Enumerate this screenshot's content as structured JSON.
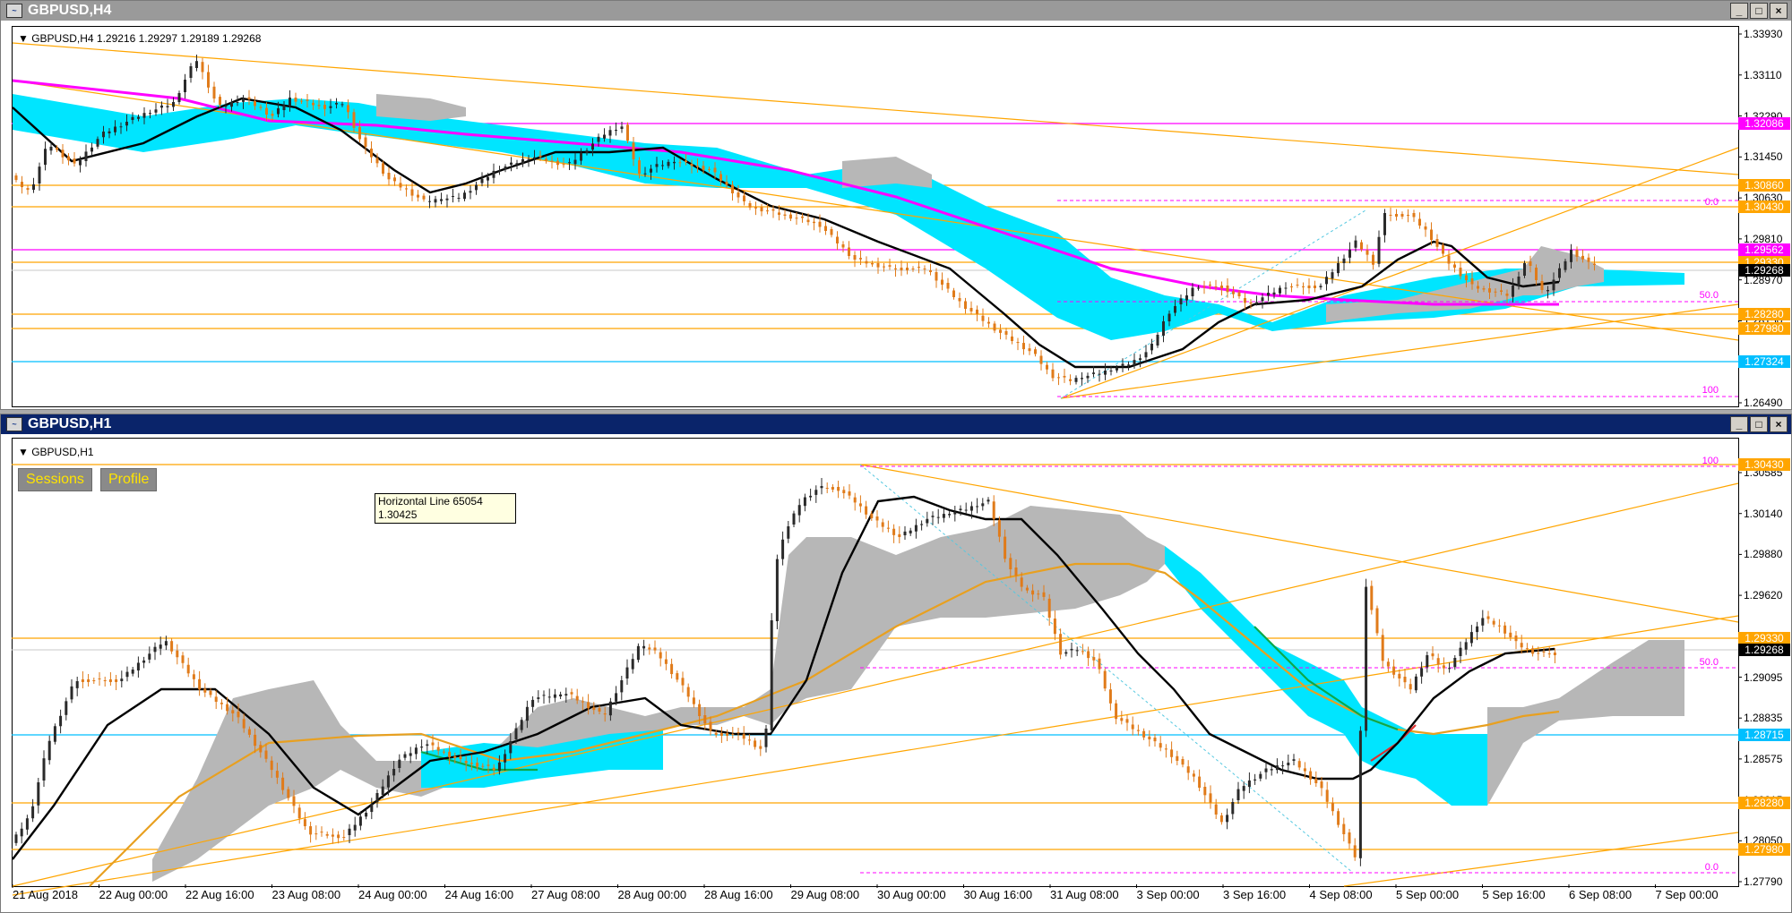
{
  "h4": {
    "title": "GBPUSD,H4",
    "info": "GBPUSD,H4  1.29216 1.29297 1.29189 1.29268",
    "axis_labels": [
      "1.33930",
      "1.33110",
      "1.32290",
      "1.31450",
      "1.30630",
      "1.29810",
      "1.28970",
      "1.28150",
      "1.27310",
      "1.26490"
    ],
    "tags": [
      {
        "text": "1.32086",
        "bg": "#ff00ff",
        "fg": "#ffffff"
      },
      {
        "text": "1.30860",
        "bg": "#ffa500",
        "fg": "#ffffff"
      },
      {
        "text": "1.30430",
        "bg": "#ffa500",
        "fg": "#ffffff"
      },
      {
        "text": "1.29562",
        "bg": "#ff00ff",
        "fg": "#ffffff"
      },
      {
        "text": "1.29330",
        "bg": "#ffa500",
        "fg": "#ffffff"
      },
      {
        "text": "1.29268",
        "bg": "#000000",
        "fg": "#ffffff"
      },
      {
        "text": "1.28280",
        "bg": "#ffa500",
        "fg": "#ffffff"
      },
      {
        "text": "1.27980",
        "bg": "#ffa500",
        "fg": "#ffffff"
      },
      {
        "text": "1.27324",
        "bg": "#00bfff",
        "fg": "#ffffff"
      }
    ],
    "fib": {
      "top": "0.0",
      "mid": "50.0",
      "bottom": "100"
    }
  },
  "h1": {
    "title": "GBPUSD,H1",
    "info": "GBPUSD,H1",
    "buttons": {
      "sessions": "Sessions",
      "profile": "Profile"
    },
    "tooltip": {
      "line1": "Horizontal Line 65054",
      "line2": "1.30425"
    },
    "axis_labels": [
      "1.30585",
      "1.30140",
      "1.29880",
      "1.29620",
      "1.29360",
      "1.29095",
      "1.28835",
      "1.28575",
      "1.28315",
      "1.28050",
      "1.27790"
    ],
    "tags": [
      {
        "text": "1.30430",
        "bg": "#ffa500",
        "fg": "#ffffff"
      },
      {
        "text": "1.29330",
        "bg": "#ffa500",
        "fg": "#ffffff"
      },
      {
        "text": "1.29268",
        "bg": "#000000",
        "fg": "#ffffff"
      },
      {
        "text": "1.28715",
        "bg": "#00bfff",
        "fg": "#ffffff"
      },
      {
        "text": "1.28280",
        "bg": "#ffa500",
        "fg": "#ffffff"
      },
      {
        "text": "1.27980",
        "bg": "#ffa500",
        "fg": "#ffffff"
      }
    ],
    "fib": {
      "top": "100",
      "mid": "50.0",
      "bottom": "0.0"
    },
    "x_labels": [
      "21 Aug 2018",
      "22 Aug 00:00",
      "22 Aug 16:00",
      "23 Aug 08:00",
      "24 Aug 00:00",
      "24 Aug 16:00",
      "27 Aug 08:00",
      "28 Aug 00:00",
      "28 Aug 16:00",
      "29 Aug 08:00",
      "30 Aug 00:00",
      "30 Aug 16:00",
      "31 Aug 08:00",
      "3 Sep 00:00",
      "3 Sep 16:00",
      "4 Sep 08:00",
      "5 Sep 00:00",
      "5 Sep 16:00",
      "6 Sep 08:00",
      "7 Sep 00:00"
    ]
  },
  "colors": {
    "bull": "#2a2a2a",
    "bear": "#e07b1a",
    "cloud": "#00e5ff",
    "cloud_alt": "#b7b7b7",
    "ma": "#000000",
    "magenta": "#ff00ff",
    "orange": "#ffa500",
    "cyan": "#00bfff"
  }
}
